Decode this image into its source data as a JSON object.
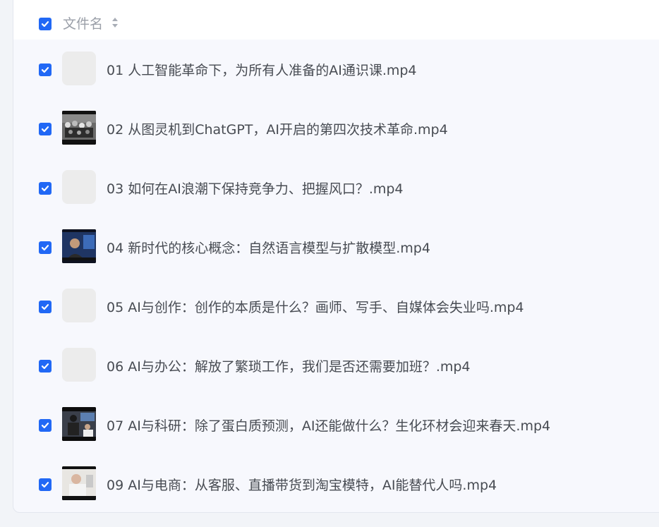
{
  "header": {
    "column_label": "文件名"
  },
  "files": [
    {
      "name": "01 人工智能革命下，为所有人准备的AI通识课.mp4",
      "thumbnail": "placeholder"
    },
    {
      "name": "02 从图灵机到ChatGPT，AI开启的第四次技术革命.mp4",
      "thumbnail": "video-frame"
    },
    {
      "name": "03 如何在AI浪潮下保持竞争力、把握风口？.mp4",
      "thumbnail": "placeholder"
    },
    {
      "name": "04 新时代的核心概念：自然语言模型与扩散模型.mp4",
      "thumbnail": "video-frame"
    },
    {
      "name": "05 AI与创作：创作的本质是什么？画师、写手、自媒体会失业吗.mp4",
      "thumbnail": "placeholder"
    },
    {
      "name": "06 AI与办公：解放了繁琐工作，我们是否还需要加班？.mp4",
      "thumbnail": "placeholder"
    },
    {
      "name": "07 AI与科研：除了蛋白质预测，AI还能做什么？生化环材会迎来春天.mp4",
      "thumbnail": "video-frame"
    },
    {
      "name": "09 AI与电商：从客服、直播带货到淘宝模特，AI能替代人吗.mp4",
      "thumbnail": "video-frame"
    }
  ],
  "colors": {
    "checkbox": "#2168f5",
    "panel": "#f7f8fd",
    "header": "#ffffff"
  }
}
